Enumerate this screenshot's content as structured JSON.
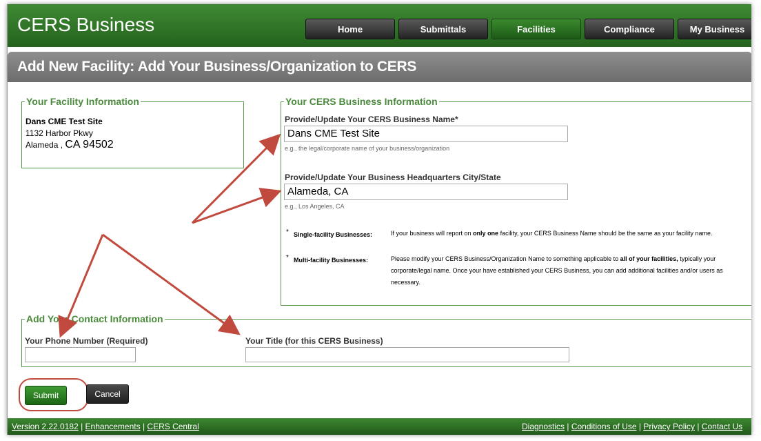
{
  "header": {
    "brand": "CERS Business",
    "nav": [
      "Home",
      "Submittals",
      "Facilities",
      "Compliance",
      "My Business"
    ]
  },
  "page_title": "Add New Facility: Add Your Business/Organization to CERS",
  "facility": {
    "legend": "Your Facility Information",
    "name": "Dans CME Test Site",
    "address": "1132 Harbor Pkwy",
    "city": "Alameda ,",
    "state_zip": "CA  94502"
  },
  "business": {
    "legend": "Your CERS Business Information",
    "name_label": "Provide/Update Your CERS Business Name*",
    "name_value": "Dans CME Test Site",
    "name_hint": "e.g., the legal/corporate name of your business/organization",
    "hq_label": "Provide/Update Your Business Headquarters City/State",
    "hq_value": "Alameda, CA",
    "hq_hint": "e.g., Los Angeles, CA",
    "notes": [
      {
        "star": "*",
        "heading": "Single-facility Businesses:",
        "text_before": "If your business will report on ",
        "bold": "only one",
        "text_after": " facility, your CERS Business Name should be the same as your facility name."
      },
      {
        "star": "*",
        "heading": "Multi-facility Businesses:",
        "text_before": "Please modify your CERS Business/Organization Name to something applicable to ",
        "bold": "all of your facilities,",
        "text_after": " typically your corporate/legal name. Once your have established your CERS Business, you can add additional facilities and/or users as necessary."
      }
    ]
  },
  "contact": {
    "legend": "Add Your Contact Information",
    "phone_label": "Your Phone Number (Required)",
    "phone_value": "",
    "title_label": "Your Title (for this CERS Business)",
    "title_value": ""
  },
  "buttons": {
    "submit": "Submit",
    "cancel": "Cancel"
  },
  "footer": {
    "version": "Version 2.22.0182",
    "enhancements": "Enhancements",
    "cers_central": "CERS Central",
    "diagnostics": "Diagnostics",
    "conditions": "Conditions of Use",
    "privacy": "Privacy Policy",
    "contact": "Contact Us"
  },
  "colors": {
    "green": "#2f7a26",
    "arrow": "#c04a3e"
  }
}
